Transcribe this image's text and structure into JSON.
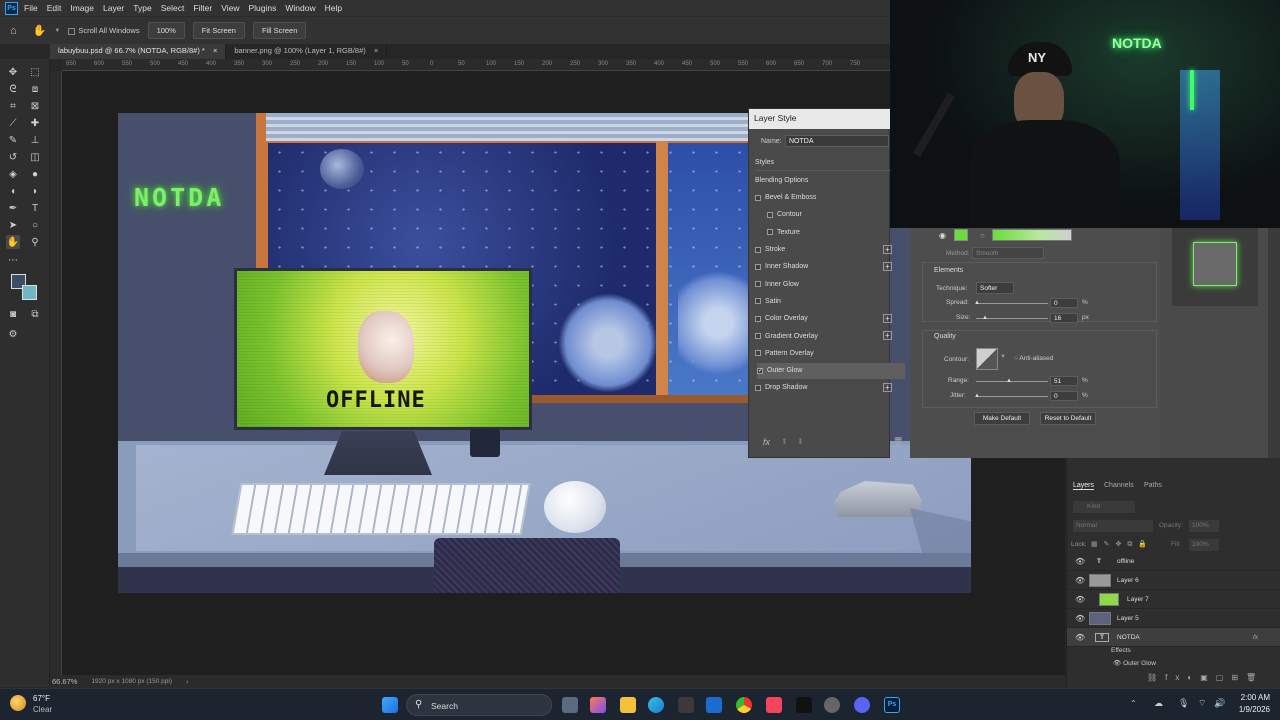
{
  "app": {
    "logo": "Ps"
  },
  "menu": [
    "File",
    "Edit",
    "Image",
    "Layer",
    "Type",
    "Select",
    "Filter",
    "View",
    "Plugins",
    "Window",
    "Help"
  ],
  "options": {
    "scroll_all": "Scroll All Windows",
    "zoom_value": "100%",
    "fit_screen": "Fit Screen",
    "fill_screen": "Fill Screen"
  },
  "tabs": [
    {
      "label": "labuybuu.psd @ 66.7% (NOTDA, RGB/8#) *",
      "active": true
    },
    {
      "label": "banner.png @ 100% (Layer 1, RGB/8#)",
      "active": false
    }
  ],
  "ruler_ticks": [
    "650",
    "600",
    "550",
    "500",
    "450",
    "400",
    "350",
    "300",
    "250",
    "200",
    "150",
    "100",
    "50",
    "0",
    "50",
    "100",
    "150",
    "200",
    "250",
    "300",
    "350",
    "400",
    "450",
    "500",
    "550",
    "600",
    "650",
    "700",
    "750"
  ],
  "artwork": {
    "neon_text": "NOTDA",
    "monitor_text": "OFFLINE"
  },
  "status": {
    "zoom": "66.67%",
    "doc_info": "1920 px x 1080 px (150 ppi)"
  },
  "layer_style": {
    "title": "Layer Style",
    "name_label": "Name:",
    "name_value": "NOTDA",
    "items": [
      {
        "label": "Styles"
      },
      {
        "label": "Blending Options"
      },
      {
        "label": "Bevel & Emboss"
      },
      {
        "label": "Contour"
      },
      {
        "label": "Texture"
      },
      {
        "label": "Stroke"
      },
      {
        "label": "Inner Shadow"
      },
      {
        "label": "Inner Glow"
      },
      {
        "label": "Satin"
      },
      {
        "label": "Color Overlay"
      },
      {
        "label": "Gradient Overlay"
      },
      {
        "label": "Pattern Overlay"
      },
      {
        "label": "Outer Glow"
      },
      {
        "label": "Drop Shadow"
      }
    ],
    "fx": "fx",
    "method_label": "Method:",
    "method_value": "Smooth",
    "elements_header": "Elements",
    "technique_label": "Technique:",
    "technique_value": "Softer",
    "spread_label": "Spread:",
    "spread_value": "0",
    "spread_unit": "%",
    "size_label": "Size:",
    "size_value": "16",
    "size_unit": "px",
    "quality_header": "Quality",
    "contour_label": "Contour:",
    "anti_aliased": "Anti-aliased",
    "range_label": "Range:",
    "range_value": "51",
    "range_unit": "%",
    "jitter_label": "Jitter:",
    "jitter_value": "0",
    "jitter_unit": "%",
    "make_default": "Make Default",
    "reset_default": "Reset to Default",
    "glow_color": "#6bdc3c"
  },
  "webcam": {
    "neon_sign": "NOTDA",
    "cap_logo": "NY"
  },
  "layers_panel": {
    "tabs": [
      "Layers",
      "Channels",
      "Paths"
    ],
    "kind": "Kind",
    "blend_mode": "Normal",
    "opacity_label": "Opacity:",
    "opacity_value": "100%",
    "lock_label": "Lock:",
    "fill_label": "Fill:",
    "fill_value": "100%",
    "layers": [
      {
        "name": "offline",
        "kind": "text"
      },
      {
        "name": "Layer 6",
        "kind": "pixel"
      },
      {
        "name": "Layer 7",
        "kind": "pixel"
      },
      {
        "name": "Layer 5",
        "kind": "pixel"
      },
      {
        "name": "NOTDA",
        "kind": "text"
      }
    ],
    "effects_label": "Effects",
    "outer_glow_label": "Outer Glow",
    "layer_fx": "fx"
  },
  "taskbar": {
    "temp": "67°F",
    "weather": "Clear",
    "search_placeholder": "Search",
    "time": "2:00 AM",
    "date": "1/9/2026"
  }
}
